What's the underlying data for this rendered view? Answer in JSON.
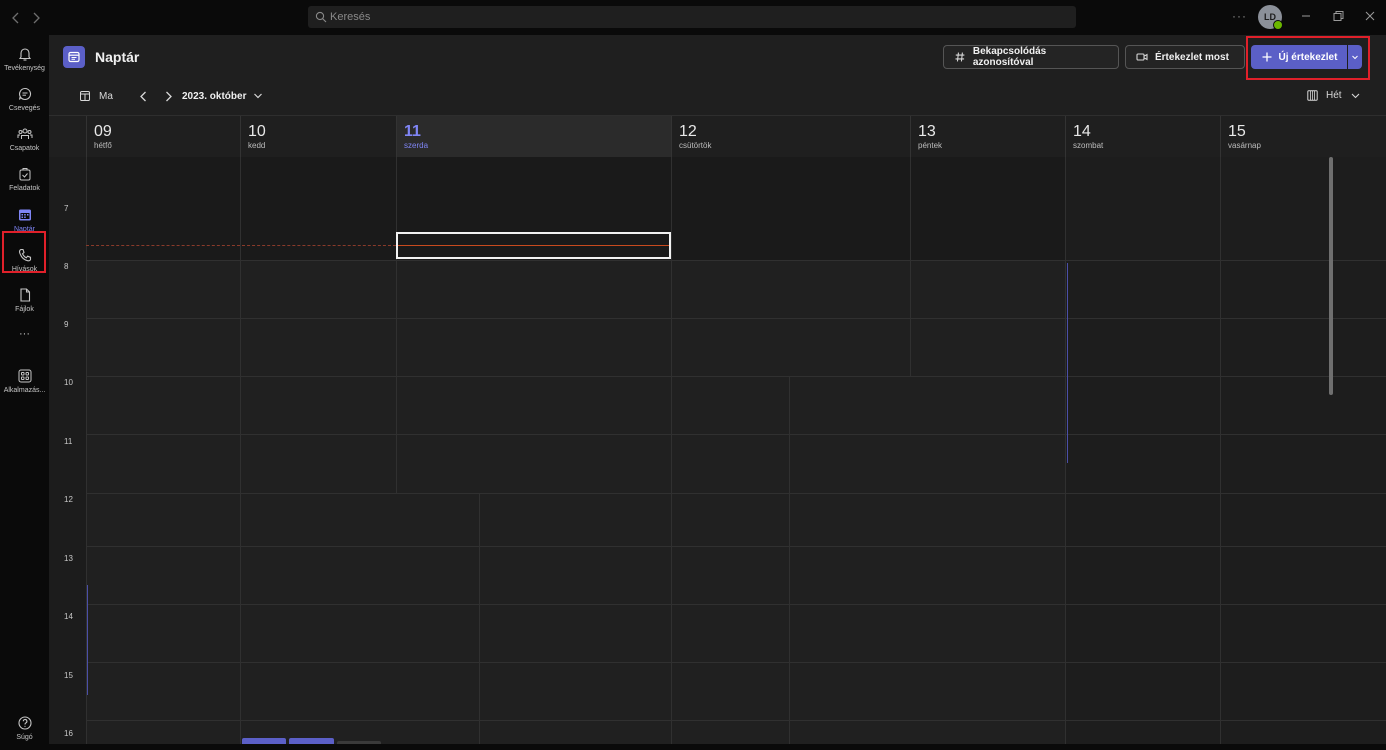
{
  "titlebar": {
    "search_placeholder": "Keresés",
    "more_label": "···",
    "avatar_initials": "LD"
  },
  "rail": {
    "items": [
      {
        "label": "Tevékenység",
        "icon": "bell-icon"
      },
      {
        "label": "Csevegés",
        "icon": "chat-icon"
      },
      {
        "label": "Csapatok",
        "icon": "teams-icon"
      },
      {
        "label": "Feladatok",
        "icon": "tasks-icon"
      },
      {
        "label": "Naptár",
        "icon": "calendar-icon",
        "active": true
      },
      {
        "label": "Hívások",
        "icon": "phone-icon"
      },
      {
        "label": "Fájlok",
        "icon": "file-icon"
      },
      {
        "label": "···",
        "icon": "more-icon"
      },
      {
        "label": "Alkalmazás...",
        "icon": "apps-icon"
      }
    ],
    "help_label": "Súgó"
  },
  "header": {
    "title": "Naptár",
    "join_with_id_label": "Bekapcsolódás azonosítóval",
    "meet_now_label": "Értekezlet most",
    "new_meeting_label": "Új értekezlet"
  },
  "toolbar": {
    "today_label": "Ma",
    "month_label": "2023. október",
    "view_label": "Hét"
  },
  "days": [
    {
      "num": "09",
      "name": "hétfő"
    },
    {
      "num": "10",
      "name": "kedd"
    },
    {
      "num": "11",
      "name": "szerda",
      "today": true
    },
    {
      "num": "12",
      "name": "csütörtök"
    },
    {
      "num": "13",
      "name": "péntek"
    },
    {
      "num": "14",
      "name": "szombat"
    },
    {
      "num": "15",
      "name": "vasárnap"
    }
  ],
  "hours": [
    "7",
    "8",
    "9",
    "10",
    "11",
    "12",
    "13",
    "14",
    "15",
    "16"
  ],
  "colors": {
    "accent": "#5b5fc7",
    "accent_text": "#7f85f5",
    "highlight": "#e0202a",
    "current_time": "#c84a1e"
  }
}
